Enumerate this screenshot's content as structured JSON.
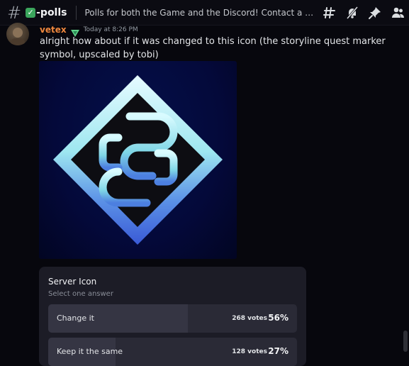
{
  "header": {
    "channel_name": "-polls",
    "topic": "Polls for both the Game and the Discord! Contact a Staff Lead if you...",
    "icons": [
      "threads-icon",
      "mute-bell-icon",
      "pin-icon",
      "members-icon"
    ]
  },
  "message": {
    "author": "vetex",
    "author_color": "#f0883e",
    "timestamp": "Today at 8:26 PM",
    "text": "alright how about if it was changed to this icon (the storyline quest marker symbol, upscaled by tobi)"
  },
  "poll": {
    "question": "Server Icon",
    "hint": "Select one answer",
    "answers": [
      {
        "label": "Change it",
        "votes": "268 votes",
        "percent": "56%",
        "fill": 0.56
      },
      {
        "label": "Keep it the same",
        "votes": "128 votes",
        "percent": "27%",
        "fill": 0.27
      }
    ]
  }
}
